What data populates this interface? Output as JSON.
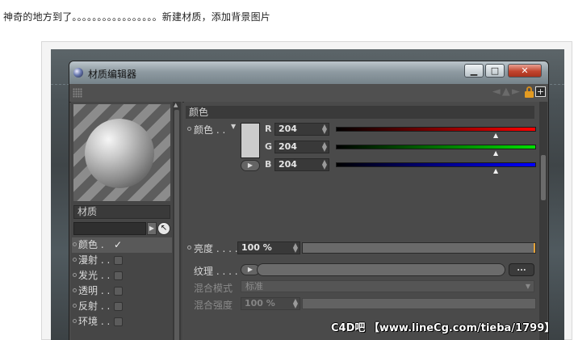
{
  "caption": "神奇的地方到了。。。。。。。。。。。。。。。。。新建材质，添加背景图片",
  "window": {
    "title": "材质编辑器",
    "controls": {
      "minimize": "▁",
      "maximize": "□",
      "close": "✕"
    }
  },
  "toolbar": {
    "arrows": "◄ ▲ ►"
  },
  "left_panel": {
    "material_name": "材质",
    "channels": [
      {
        "label": "颜色 .",
        "checked": true,
        "mark": "✓"
      },
      {
        "label": "漫射 . .",
        "checked": false,
        "mark": ""
      },
      {
        "label": "发光 . .",
        "checked": false,
        "mark": ""
      },
      {
        "label": "透明 . .",
        "checked": false,
        "mark": ""
      },
      {
        "label": "反射 . .",
        "checked": false,
        "mark": ""
      },
      {
        "label": "环境 . .",
        "checked": false,
        "mark": ""
      }
    ]
  },
  "color_section": {
    "header": "颜色",
    "color_label": "颜色 . .",
    "swatch_color": "#cccccc",
    "r_label": "R",
    "r_value": "204",
    "g_label": "G",
    "g_value": "204",
    "b_label": "B",
    "b_value": "204",
    "brightness_label": "亮度 . . . .",
    "brightness_value": "100 %",
    "texture_label": "纹理 . . . .",
    "more_button": "...",
    "mix_mode_label": "混合模式",
    "mix_mode_value": "标准",
    "mix_strength_label": "混合强度",
    "mix_strength_value": "100 %"
  },
  "watermark": "C4D吧 【www.lineCg.com/tieba/1799】"
}
